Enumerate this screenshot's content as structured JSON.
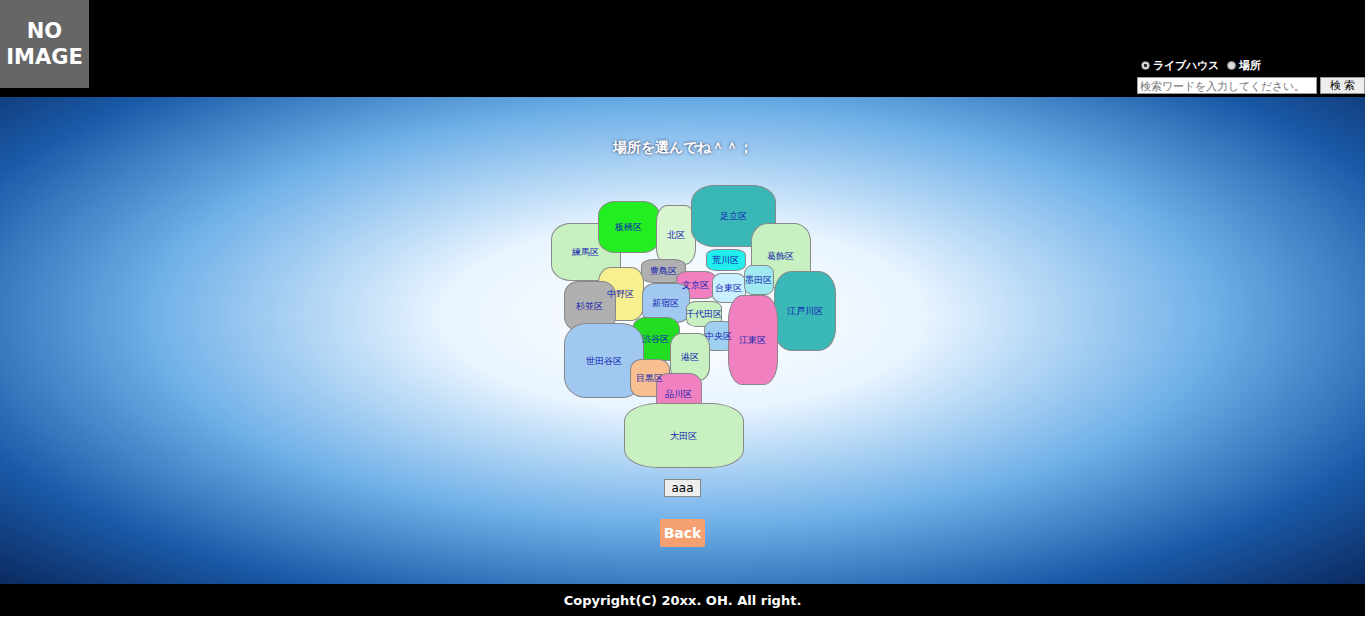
{
  "header": {
    "logo": "NO IMAGE",
    "radios": [
      {
        "label": "ライブハウス",
        "selected": true
      },
      {
        "label": "場所",
        "selected": false
      }
    ],
    "search": {
      "placeholder": "検索ワードを入力してください。",
      "button": "検 索"
    }
  },
  "main": {
    "title": "場所を選んでね＾＾；",
    "map": {
      "wards": [
        {
          "name": "練馬区",
          "color": "#c8f0c0"
        },
        {
          "name": "板橋区",
          "color": "#22ee22"
        },
        {
          "name": "北区",
          "color": "#d8f5d0"
        },
        {
          "name": "足立区",
          "color": "#3ab8b8"
        },
        {
          "name": "葛飾区",
          "color": "#c8f0c0"
        },
        {
          "name": "荒川区",
          "color": "#22eeee"
        },
        {
          "name": "豊島区",
          "color": "#b0b0b0"
        },
        {
          "name": "文京区",
          "color": "#f080c0"
        },
        {
          "name": "台東区",
          "color": "#c8f0ff"
        },
        {
          "name": "墨田区",
          "color": "#a0e8f0"
        },
        {
          "name": "江戸川区",
          "color": "#3ab8b8"
        },
        {
          "name": "中野区",
          "color": "#f8f090"
        },
        {
          "name": "杉並区",
          "color": "#b0b0b0"
        },
        {
          "name": "新宿区",
          "color": "#a0c8f0"
        },
        {
          "name": "千代田区",
          "color": "#c8f0c0"
        },
        {
          "name": "中央区",
          "color": "#a0d0f0"
        },
        {
          "name": "江東区",
          "color": "#f080c0"
        },
        {
          "name": "渋谷区",
          "color": "#22dd22"
        },
        {
          "name": "港区",
          "color": "#c8f0c0"
        },
        {
          "name": "世田谷区",
          "color": "#a0c8f0"
        },
        {
          "name": "目黒区",
          "color": "#f8c090"
        },
        {
          "name": "品川区",
          "color": "#f080c0"
        },
        {
          "name": "大田区",
          "color": "#c8f0c0"
        }
      ]
    },
    "buttons": [
      {
        "label": "aaa",
        "kind": "plain"
      },
      {
        "label": "Back",
        "kind": "accent"
      }
    ]
  },
  "footer": {
    "text": "Copyright(C) 20xx. OH. All right."
  }
}
